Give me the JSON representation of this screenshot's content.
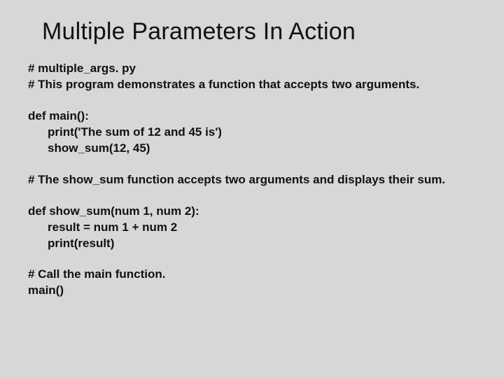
{
  "title": "Multiple Parameters In Action",
  "b1": {
    "l1": "# multiple_args. py",
    "l2": "# This program demonstrates a function that accepts two arguments."
  },
  "b2": {
    "l1": "def main():",
    "l2": "print('The sum of 12 and 45 is')",
    "l3": "show_sum(12, 45)"
  },
  "b3": {
    "l1": "# The show_sum function accepts two arguments and displays their sum."
  },
  "b4": {
    "l1": "def show_sum(num 1, num 2):",
    "l2": "result = num 1 + num 2",
    "l3": "print(result)"
  },
  "b5": {
    "l1": "# Call the main function.",
    "l2": "main()"
  }
}
